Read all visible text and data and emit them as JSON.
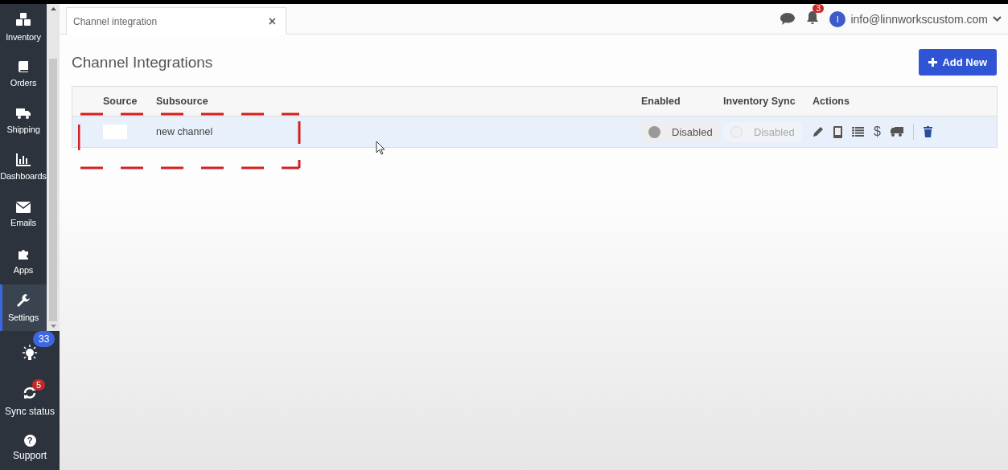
{
  "sidebar": {
    "items": [
      {
        "label": "Inventory",
        "selected": false
      },
      {
        "label": "Orders",
        "selected": false
      },
      {
        "label": "Shipping",
        "selected": false
      },
      {
        "label": "Dashboards",
        "selected": false
      },
      {
        "label": "Emails",
        "selected": false
      },
      {
        "label": "Apps",
        "selected": false
      },
      {
        "label": "Settings",
        "selected": true
      }
    ],
    "extras": [
      {
        "kind": "tips",
        "badge": "33"
      },
      {
        "kind": "sync",
        "label": "Sync status",
        "badge": "5"
      },
      {
        "kind": "support",
        "label": "Support",
        "glyph": "?"
      }
    ]
  },
  "tab": {
    "label": "Channel integration",
    "close": "×"
  },
  "header": {
    "notifications": "3",
    "avatar": "I",
    "email": "info@linnworkscustom.com"
  },
  "page": {
    "title": "Channel Integrations",
    "add_button": "Add New"
  },
  "table": {
    "columns": [
      "Source",
      "Subsource",
      "Enabled",
      "Inventory Sync",
      "Actions"
    ],
    "rows": [
      {
        "subsource": "new channel",
        "selected": true,
        "enabled": {
          "on": false,
          "label": "Disabled",
          "disabled": false
        },
        "inventory_sync": {
          "on": false,
          "label": "Disabled",
          "disabled": true
        },
        "actions": [
          {
            "kind": "edit"
          },
          {
            "kind": "device"
          },
          {
            "kind": "list"
          },
          {
            "kind": "price",
            "glyph": "$"
          },
          {
            "kind": "truck"
          },
          {
            "kind": "delete"
          }
        ]
      }
    ]
  }
}
